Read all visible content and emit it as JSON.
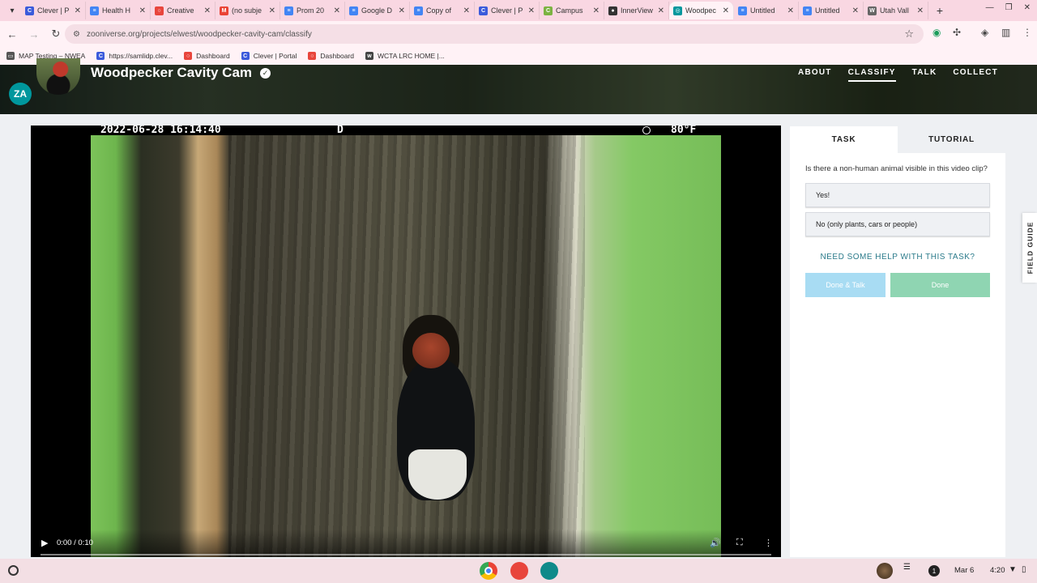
{
  "browser": {
    "tabs": [
      {
        "label": "Clever | P",
        "icon": "clever-icon",
        "color": "#3b5bdb",
        "glyph": "C"
      },
      {
        "label": "Health H",
        "icon": "docs-icon",
        "color": "#4285f4",
        "glyph": "≡"
      },
      {
        "label": "Creative",
        "icon": "dashboard-icon",
        "color": "#e8453c",
        "glyph": "○"
      },
      {
        "label": "(no subje",
        "icon": "gmail-icon",
        "color": "#ea4335",
        "glyph": "M"
      },
      {
        "label": "Prom 20",
        "icon": "docs-icon",
        "color": "#4285f4",
        "glyph": "≡"
      },
      {
        "label": "Google D",
        "icon": "docs-icon",
        "color": "#4285f4",
        "glyph": "≡"
      },
      {
        "label": "Copy of",
        "icon": "docs-icon",
        "color": "#4285f4",
        "glyph": "≡"
      },
      {
        "label": "Clever | P",
        "icon": "clever-icon",
        "color": "#3b5bdb",
        "glyph": "C"
      },
      {
        "label": "Campus",
        "icon": "campus-icon",
        "color": "#7cb342",
        "glyph": "C"
      },
      {
        "label": "InnerView",
        "icon": "innerview-icon",
        "color": "#333333",
        "glyph": "●"
      },
      {
        "label": "Woodpec",
        "icon": "zooniverse-icon",
        "color": "#00979d",
        "glyph": "◎",
        "active": true
      },
      {
        "label": "Untitled",
        "icon": "docs-icon",
        "color": "#4285f4",
        "glyph": "≡"
      },
      {
        "label": "Untitled",
        "icon": "docs-icon",
        "color": "#4285f4",
        "glyph": "≡"
      },
      {
        "label": "Utah Vall",
        "icon": "wikipedia-icon",
        "color": "#666666",
        "glyph": "W"
      }
    ],
    "url": "zooniverse.org/projects/elwest/woodpecker-cavity-cam/classify",
    "bookmarks": [
      {
        "label": "MAP Testing – NWEA",
        "icon": "folder-icon",
        "color": "#555555",
        "glyph": "▭"
      },
      {
        "label": "https://samlidp.clev...",
        "icon": "clever-icon",
        "color": "#3b5bdb",
        "glyph": "C"
      },
      {
        "label": "Dashboard",
        "icon": "dashboard-icon",
        "color": "#e8453c",
        "glyph": "○"
      },
      {
        "label": "Clever | Portal",
        "icon": "clever-icon",
        "color": "#3b5bdb",
        "glyph": "C"
      },
      {
        "label": "Dashboard",
        "icon": "dashboard-icon",
        "color": "#e8453c",
        "glyph": "○"
      },
      {
        "label": "WCTA LRC HOME |...",
        "icon": "wcta-icon",
        "color": "#444444",
        "glyph": "w"
      }
    ]
  },
  "project": {
    "title": "Woodpecker Cavity Cam",
    "nav": [
      {
        "label": "ABOUT",
        "active": false
      },
      {
        "label": "CLASSIFY",
        "active": true
      },
      {
        "label": "TALK",
        "active": false
      },
      {
        "label": "COLLECT",
        "active": false
      }
    ]
  },
  "video": {
    "timestamp": "2022-06-28  16:14:40",
    "mode": "D",
    "temperature": "80°F",
    "time_display": "0:00 / 0:10",
    "progress": 0
  },
  "task": {
    "tabs": {
      "task": "TASK",
      "tutorial": "TUTORIAL"
    },
    "question": "Is there a non-human animal visible in this video clip?",
    "answers": [
      "Yes!",
      "No (only plants, cars or people)"
    ],
    "help": "NEED SOME HELP WITH THIS TASK?",
    "done_talk": "Done & Talk",
    "done": "Done",
    "field_guide": "FIELD GUIDE"
  },
  "shelf": {
    "notifications": "1",
    "date": "Mar 6",
    "time": "4:20"
  },
  "colors": {
    "accent": "#00979d",
    "done": "#8fd5b2",
    "done_talk": "#a8dcf3",
    "chrome_tint": "#f9d7e2"
  }
}
